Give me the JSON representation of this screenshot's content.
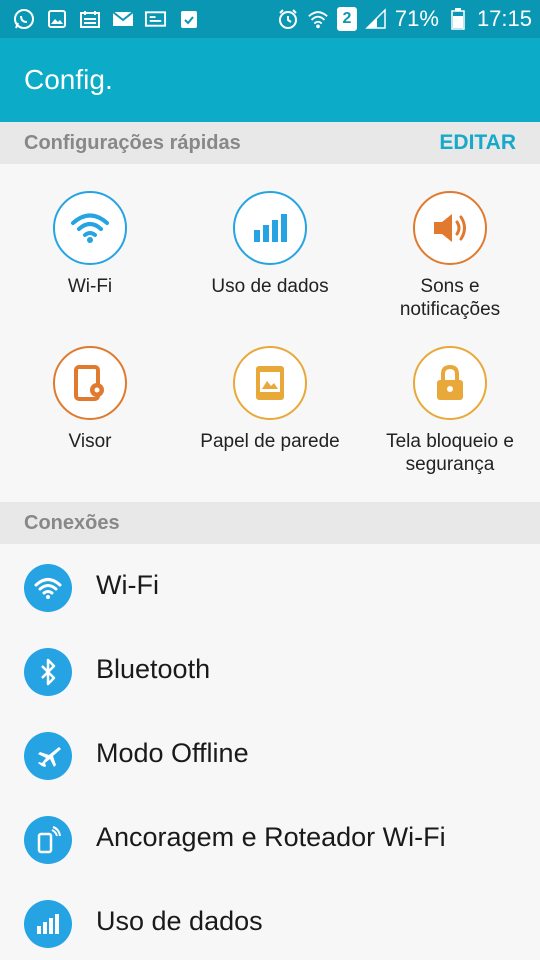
{
  "status": {
    "battery": "71%",
    "time": "17:15",
    "sim": "2"
  },
  "header": {
    "title": "Config."
  },
  "quick_settings": {
    "section_label": "Configurações rápidas",
    "edit_label": "EDITAR",
    "items": [
      {
        "label": "Wi-Fi",
        "color": "#26a3e2"
      },
      {
        "label": "Uso de dados",
        "color": "#26a3e2"
      },
      {
        "label": "Sons e\nnotificações",
        "color": "#e07a2e"
      },
      {
        "label": "Visor",
        "color": "#e07a2e"
      },
      {
        "label": "Papel de parede",
        "color": "#e8a93a"
      },
      {
        "label": "Tela bloqueio e\nsegurança",
        "color": "#e8a93a"
      }
    ]
  },
  "connections": {
    "section_label": "Conexões",
    "items": [
      {
        "label": "Wi-Fi"
      },
      {
        "label": "Bluetooth"
      },
      {
        "label": "Modo Offline"
      },
      {
        "label": "Ancoragem e Roteador Wi-Fi"
      },
      {
        "label": "Uso de dados"
      }
    ]
  }
}
